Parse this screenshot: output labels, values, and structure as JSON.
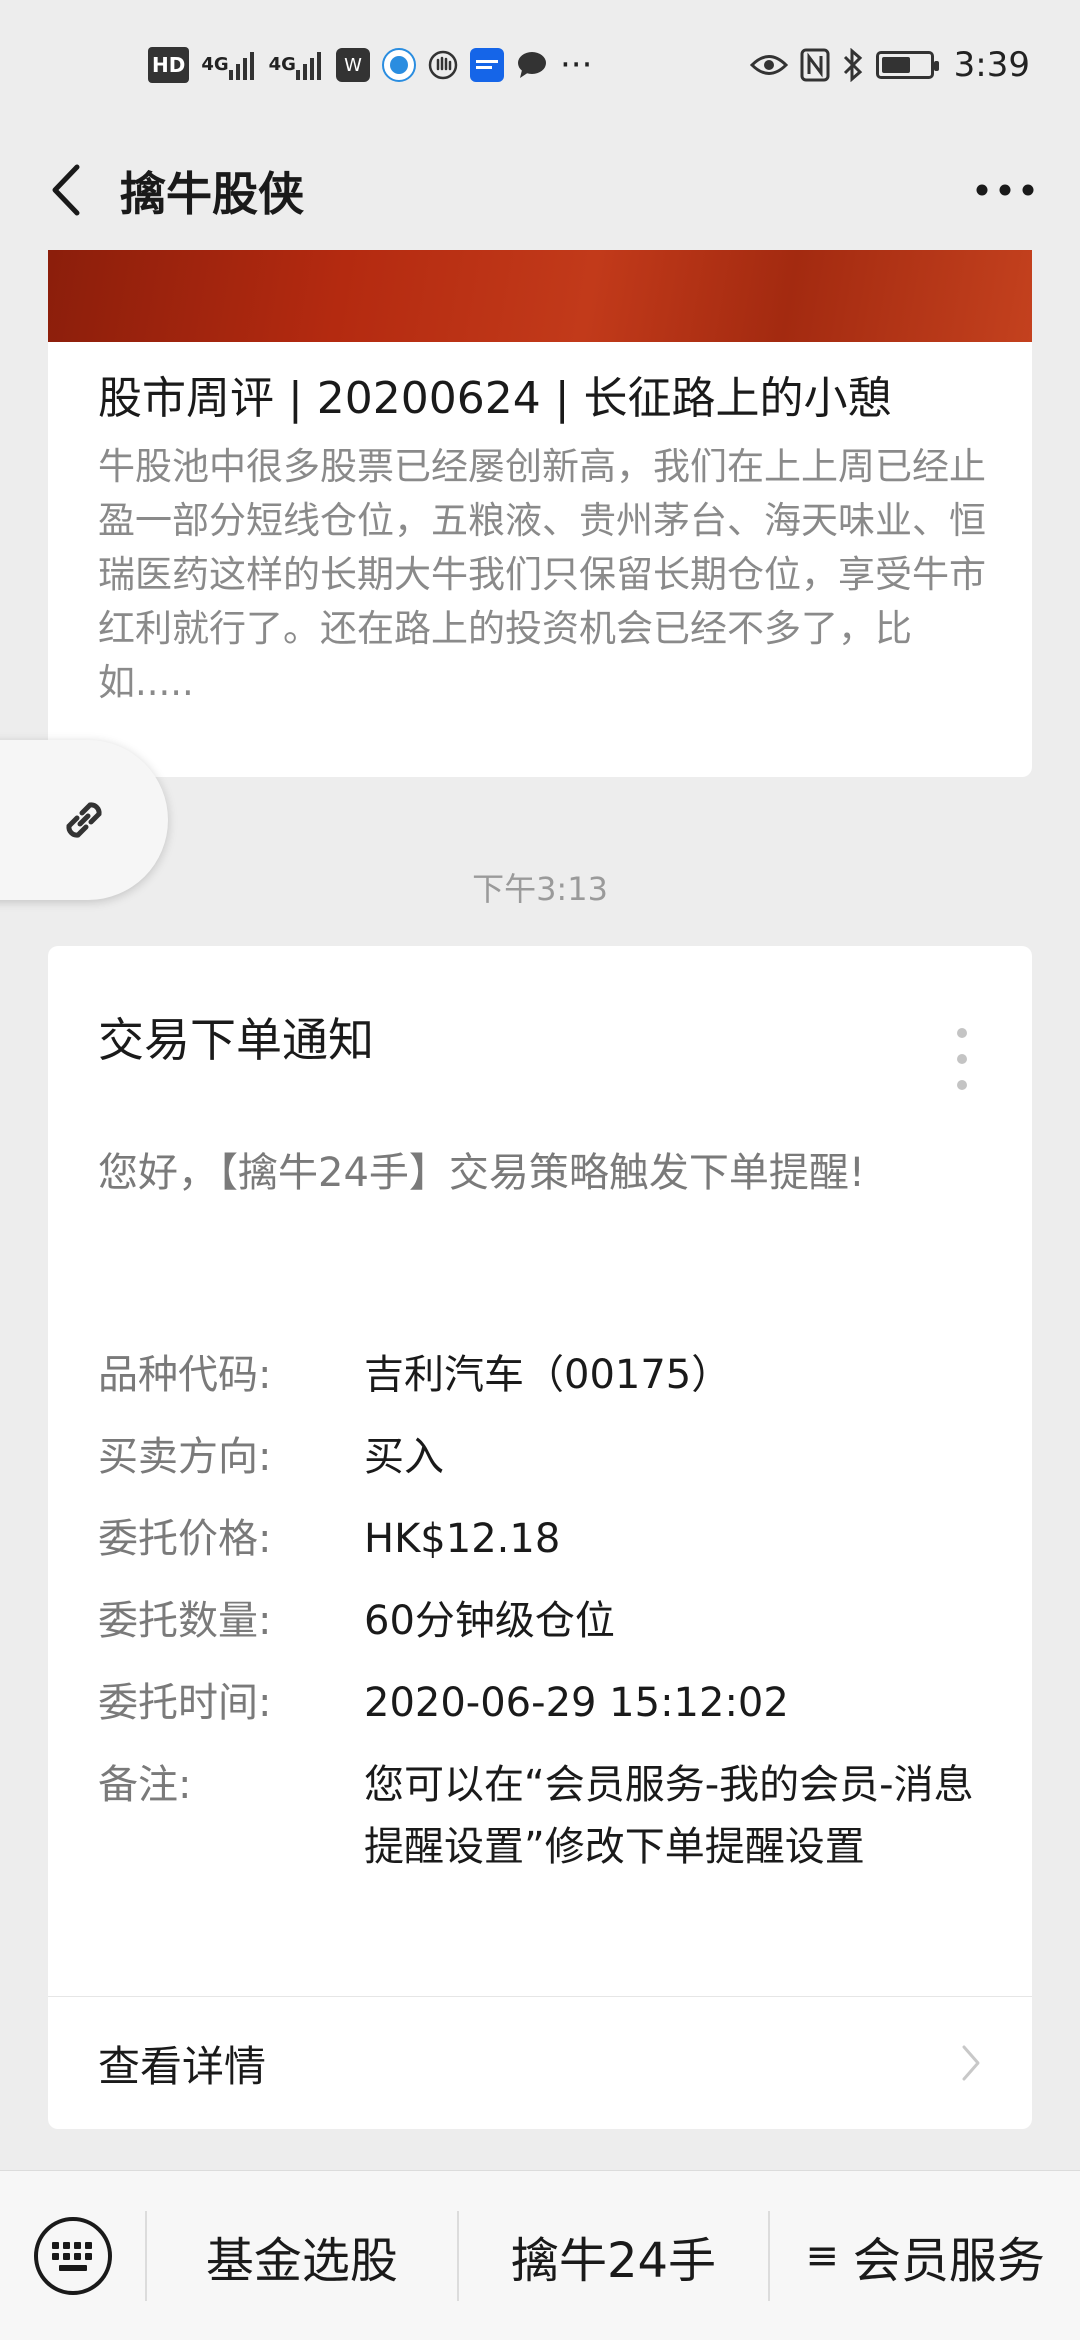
{
  "status_bar": {
    "hd": "HD",
    "net1": "4G",
    "net2": "4G",
    "app1": "W",
    "more": "···",
    "time": "3:39",
    "battery_level": 0.6
  },
  "header": {
    "title": "擒牛股侠"
  },
  "article": {
    "title": "股市周评 | 20200624 | 长征路上的小憩",
    "summary": "牛股池中很多股票已经屡创新高，我们在上上周已经止盈一部分短线仓位，五粮液、贵州茅台、海天味业、恒瑞医药这样的长期大牛我们只保留长期仓位，享受牛市红利就行了。还在路上的投资机会已经不多了，比如....."
  },
  "timestamp": "下午3:13",
  "notice": {
    "title": "交易下单通知",
    "greeting": "您好，【擒牛24手】交易策略触发下单提醒!",
    "fields": [
      {
        "label": "品种代码:",
        "value": "吉利汽车（00175）"
      },
      {
        "label": "买卖方向:",
        "value": "买入"
      },
      {
        "label": "委托价格:",
        "value": "HK$12.18"
      },
      {
        "label": "委托数量:",
        "value": "60分钟级仓位"
      },
      {
        "label": "委托时间:",
        "value": "2020-06-29 15:12:02"
      },
      {
        "label": "备注:",
        "value": "您可以在“会员服务-我的会员-消息提醒设置”修改下单提醒设置"
      }
    ],
    "detail_label": "查看详情"
  },
  "bottom_menu": {
    "items": [
      {
        "label": "基金选股"
      },
      {
        "label": "擒牛24手"
      },
      {
        "label": "会员服务",
        "glyph": "≡"
      }
    ]
  },
  "colors": {
    "background": "#ededed",
    "card": "#ffffff",
    "muted_text": "#8a8a8a",
    "banner": "#b42a10"
  }
}
